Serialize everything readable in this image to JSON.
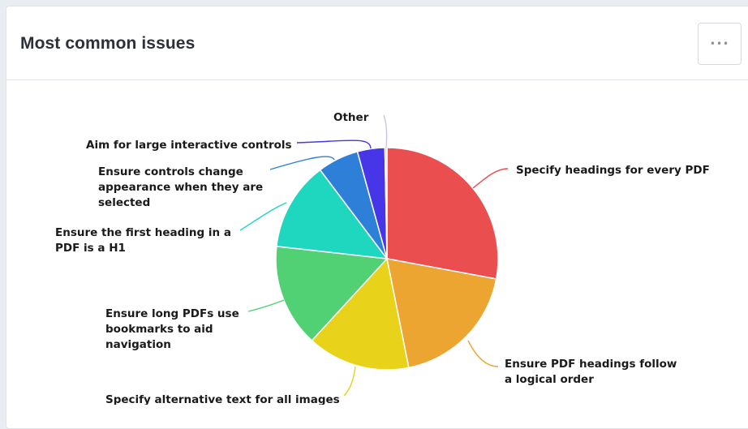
{
  "card": {
    "title": "Most common issues",
    "menu_glyph": "•••"
  },
  "chart_data": {
    "type": "pie",
    "title": "Most common issues",
    "slices": [
      {
        "label": "Specify headings for every PDF",
        "value": 28,
        "color": "#ea4e4e"
      },
      {
        "label": "Ensure PDF headings follow a logical order",
        "value": 19,
        "color": "#eba530"
      },
      {
        "label": "Specify alternative text for all images",
        "value": 15,
        "color": "#e8d21a"
      },
      {
        "label": "Ensure long PDFs use bookmarks to aid navigation",
        "value": 15,
        "color": "#52d074"
      },
      {
        "label": "Ensure the first heading in a PDF is a H1",
        "value": 13,
        "color": "#1fd6bf"
      },
      {
        "label": "Ensure controls change appearance when they are selected",
        "value": 6,
        "color": "#2d7fd8"
      },
      {
        "label": "Aim for large interactive controls",
        "value": 4,
        "color": "#4636e8"
      },
      {
        "label": "Other",
        "value": 0.3,
        "color": "#c9c3ee"
      }
    ],
    "legend": "none",
    "labels": "outside with leader lines"
  }
}
